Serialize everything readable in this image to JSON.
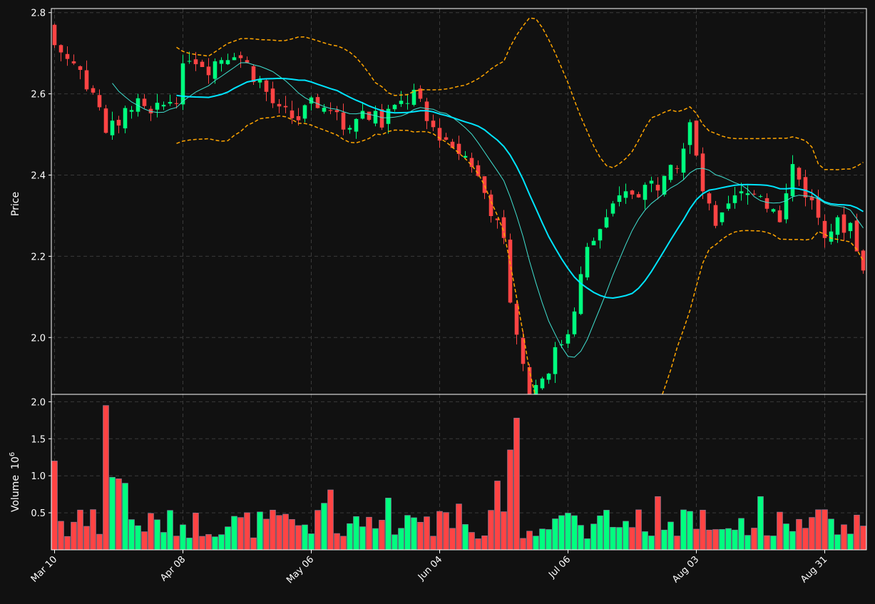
{
  "chart_data": {
    "type": "candlestick",
    "colors": {
      "background": "#111111",
      "up": "#00ff7f",
      "down": "#ff4444",
      "bollinger": "#ffa500",
      "ma_fast": "#40e0d0",
      "ma_slow": "#00e5ff",
      "grid": "#3a3a3a",
      "axis": "#ffffff",
      "text": "#ffffff"
    },
    "price_panel": {
      "ylabel": "Price",
      "ylim": [
        1.86,
        2.81
      ],
      "yticks": [
        2.0,
        2.2,
        2.4,
        2.6,
        2.8
      ],
      "ytick_labels": [
        "2.0",
        "2.2",
        "2.4",
        "2.6",
        "2.8"
      ]
    },
    "volume_panel": {
      "ylabel": "Volume",
      "ylabel_multiplier": "10",
      "ylabel_exponent": "6",
      "ylim": [
        0,
        2.1
      ],
      "yticks": [
        0.5,
        1.0,
        1.5,
        2.0
      ],
      "ytick_labels": [
        "0.5",
        "1.0",
        "1.5",
        "2.0"
      ],
      "unit": "millions"
    },
    "x_axis": {
      "ticks": [
        {
          "index": 0,
          "label": "Mar 10"
        },
        {
          "index": 20,
          "label": "Apr 08"
        },
        {
          "index": 40,
          "label": "May 06"
        },
        {
          "index": 60,
          "label": "Jun 04"
        },
        {
          "index": 80,
          "label": "Jul 06"
        },
        {
          "index": 100,
          "label": "Aug 03"
        },
        {
          "index": 120,
          "label": "Aug 31"
        }
      ]
    },
    "series": {
      "open": [],
      "high": [],
      "low": [],
      "close": [],
      "volume": []
    },
    "moving_average_windows": [
      10,
      20
    ],
    "bollinger": {
      "window": 20,
      "std": 2
    }
  }
}
